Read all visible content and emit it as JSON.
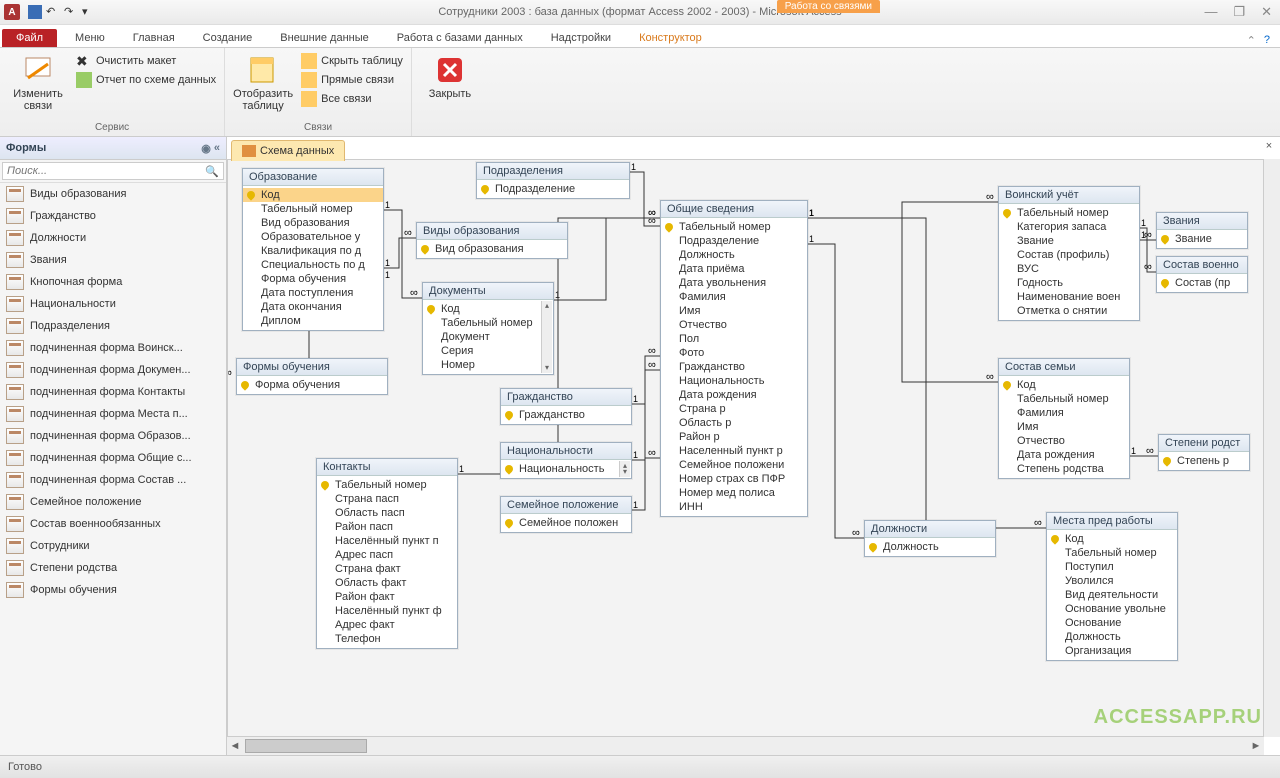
{
  "title": "Сотрудники 2003 : база данных (формат Access 2002 - 2003)  -  Microsoft Access",
  "contextual_tools": "Работа со связями",
  "tabs": {
    "file": "Файл",
    "menu": "Меню",
    "home": "Главная",
    "create": "Создание",
    "external": "Внешние данные",
    "dbtools": "Работа с базами данных",
    "addins": "Надстройки",
    "designer": "Конструктор"
  },
  "ribbon": {
    "group_service": "Сервис",
    "edit_links": "Изменить связи",
    "clear_layout": "Очистить макет",
    "rel_report": "Отчет по схеме данных",
    "group_links": "Связи",
    "show_table": "Отобразить таблицу",
    "hide_table": "Скрыть таблицу",
    "direct_links": "Прямые связи",
    "all_links": "Все связи",
    "close": "Закрыть"
  },
  "nav": {
    "header": "Формы",
    "search_placeholder": "Поиск...",
    "items": [
      "Виды образования",
      "Гражданство",
      "Должности",
      "Звания",
      "Кнопочная форма",
      "Национальности",
      "Подразделения",
      "подчиненная форма Воинск...",
      "подчиненная форма Докумен...",
      "подчиненная форма Контакты",
      "подчиненная форма Места п...",
      "подчиненная форма Образов...",
      "подчиненная форма Общие с...",
      "подчиненная форма Состав ...",
      "Семейное положение",
      "Состав военнообязанных",
      "Сотрудники",
      "Степени родства",
      "Формы обучения"
    ]
  },
  "doc_tab": "Схема данных",
  "status": "Готово",
  "watermark": "ACCESSAPP.RU",
  "tables": {
    "obrazovanie": {
      "title": "Образование",
      "fields": [
        {
          "n": "Код",
          "pk": true,
          "sel": true
        },
        {
          "n": "Табельный номер"
        },
        {
          "n": "Вид образования"
        },
        {
          "n": "Образовательное у"
        },
        {
          "n": "Квалификация по д"
        },
        {
          "n": "Специальность по д"
        },
        {
          "n": "Форма обучения"
        },
        {
          "n": "Дата поступления"
        },
        {
          "n": "Дата окончания"
        },
        {
          "n": "Диплом"
        }
      ]
    },
    "podrazd": {
      "title": "Подразделения",
      "fields": [
        {
          "n": "Подразделение",
          "pk": true
        }
      ]
    },
    "vidyobr": {
      "title": "Виды образования",
      "fields": [
        {
          "n": "Вид образования",
          "pk": true
        }
      ]
    },
    "documenty": {
      "title": "Документы",
      "fields": [
        {
          "n": "Код",
          "pk": true
        },
        {
          "n": "Табельный номер"
        },
        {
          "n": "Документ"
        },
        {
          "n": "Серия"
        },
        {
          "n": "Номер"
        }
      ]
    },
    "formyob": {
      "title": "Формы обучения",
      "fields": [
        {
          "n": "Форма обучения",
          "pk": true
        }
      ]
    },
    "grazhd": {
      "title": "Гражданство",
      "fields": [
        {
          "n": "Гражданство",
          "pk": true
        }
      ]
    },
    "national": {
      "title": "Национальности",
      "fields": [
        {
          "n": "Национальность",
          "pk": true
        }
      ]
    },
    "kontakty": {
      "title": "Контакты",
      "fields": [
        {
          "n": "Табельный номер",
          "pk": true
        },
        {
          "n": "Страна пасп"
        },
        {
          "n": "Область пасп"
        },
        {
          "n": "Район пасп"
        },
        {
          "n": "Населённый пункт п"
        },
        {
          "n": "Адрес пасп"
        },
        {
          "n": "Страна факт"
        },
        {
          "n": "Область факт"
        },
        {
          "n": "Район факт"
        },
        {
          "n": "Населённый пункт ф"
        },
        {
          "n": "Адрес факт"
        },
        {
          "n": "Телефон"
        }
      ]
    },
    "sempol": {
      "title": "Семейное положение",
      "fields": [
        {
          "n": "Семейное положен",
          "pk": true
        }
      ]
    },
    "obschie": {
      "title": "Общие сведения",
      "fields": [
        {
          "n": "Табельный номер",
          "pk": true
        },
        {
          "n": "Подразделение"
        },
        {
          "n": "Должность"
        },
        {
          "n": "Дата приёма"
        },
        {
          "n": "Дата увольнения"
        },
        {
          "n": "Фамилия"
        },
        {
          "n": "Имя"
        },
        {
          "n": "Отчество"
        },
        {
          "n": "Пол"
        },
        {
          "n": "Фото"
        },
        {
          "n": "Гражданство"
        },
        {
          "n": "Национальность"
        },
        {
          "n": "Дата рождения"
        },
        {
          "n": "Страна р"
        },
        {
          "n": "Область р"
        },
        {
          "n": "Район р"
        },
        {
          "n": "Населенный пункт р"
        },
        {
          "n": "Семейное положени"
        },
        {
          "n": "Номер страх св ПФР"
        },
        {
          "n": "Номер мед полиса"
        },
        {
          "n": "ИНН"
        }
      ]
    },
    "dolzhn": {
      "title": "Должности",
      "fields": [
        {
          "n": "Должность",
          "pk": true
        }
      ]
    },
    "voinsky": {
      "title": "Воинский учёт",
      "fields": [
        {
          "n": "Табельный номер",
          "pk": true
        },
        {
          "n": "Категория запаса"
        },
        {
          "n": "Звание"
        },
        {
          "n": "Состав (профиль)"
        },
        {
          "n": "ВУС"
        },
        {
          "n": "Годность"
        },
        {
          "n": "Наименование воен"
        },
        {
          "n": "Отметка о снятии"
        }
      ]
    },
    "zvaniya": {
      "title": "Звания",
      "fields": [
        {
          "n": "Звание",
          "pk": true
        }
      ]
    },
    "sostavv": {
      "title": "Состав военно",
      "fields": [
        {
          "n": "Состав (пр",
          "pk": true
        }
      ]
    },
    "sostavsem": {
      "title": "Состав семьи",
      "fields": [
        {
          "n": "Код",
          "pk": true
        },
        {
          "n": "Табельный номер"
        },
        {
          "n": "Фамилия"
        },
        {
          "n": "Имя"
        },
        {
          "n": "Отчество"
        },
        {
          "n": "Дата рождения"
        },
        {
          "n": "Степень родства"
        }
      ]
    },
    "steprod": {
      "title": "Степени родст",
      "fields": [
        {
          "n": "Степень р",
          "pk": true
        }
      ]
    },
    "mestapred": {
      "title": "Места пред работы",
      "fields": [
        {
          "n": "Код",
          "pk": true
        },
        {
          "n": "Табельный номер"
        },
        {
          "n": "Поступил"
        },
        {
          "n": "Уволился"
        },
        {
          "n": "Вид деятельности"
        },
        {
          "n": "Основание увольне"
        },
        {
          "n": "Основание"
        },
        {
          "n": "Должность"
        },
        {
          "n": "Организация"
        }
      ]
    }
  }
}
